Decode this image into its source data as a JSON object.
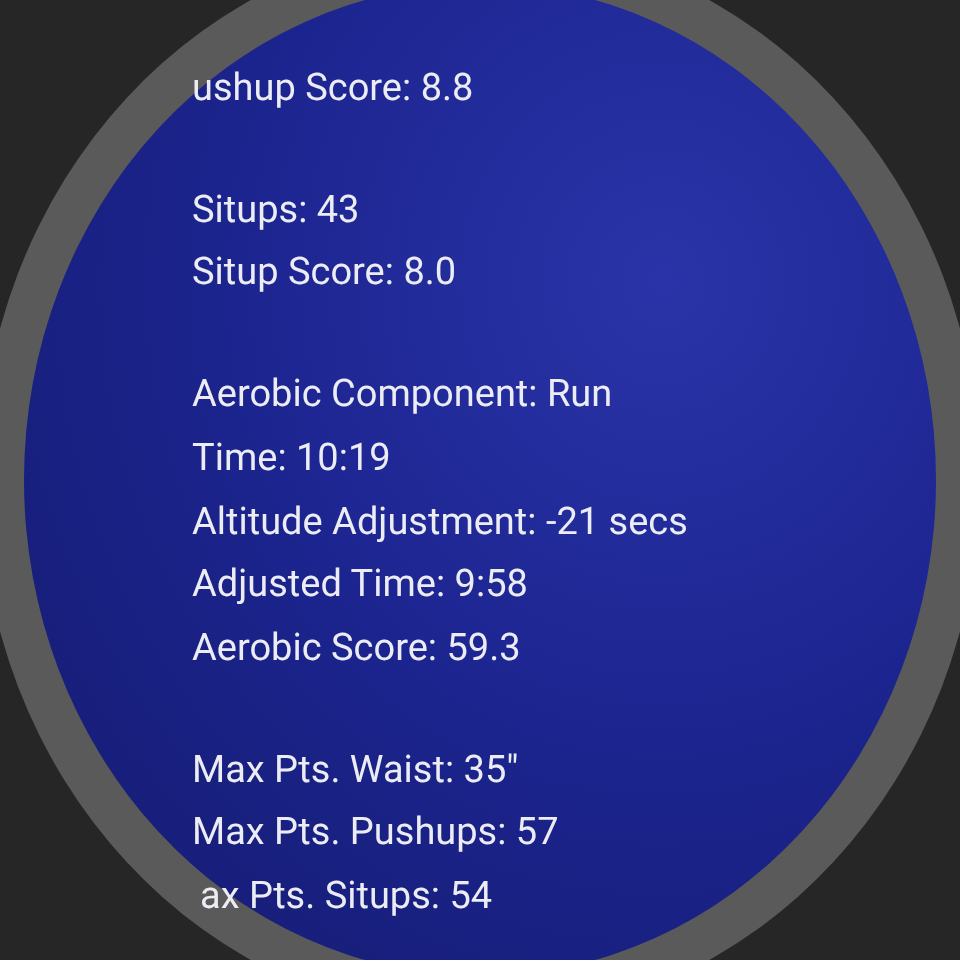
{
  "groups": [
    [
      "ushup Score: 8.8"
    ],
    [
      "Situps: 43",
      "Situp Score: 8.0"
    ],
    [
      "Aerobic Component: Run",
      "Time: 10:19",
      "Altitude Adjustment: -21 secs",
      "Adjusted Time: 9:58",
      "Aerobic Score: 59.3"
    ],
    [
      "Max Pts. Waist: 35\"",
      "Max Pts. Pushups: 57",
      "ax Pts. Situps: 54"
    ]
  ]
}
